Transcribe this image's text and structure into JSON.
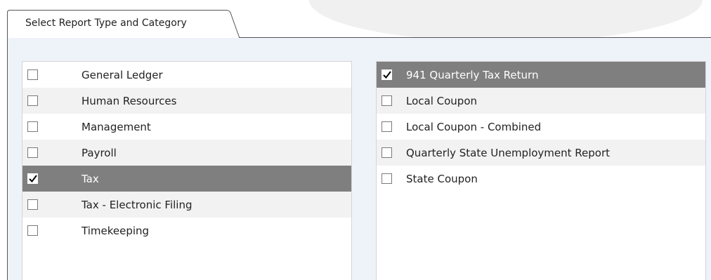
{
  "tab": {
    "label": "Select Report Type and Category"
  },
  "categories": {
    "items": [
      {
        "label": "General Ledger",
        "checked": false
      },
      {
        "label": "Human Resources",
        "checked": false
      },
      {
        "label": "Management",
        "checked": false
      },
      {
        "label": "Payroll",
        "checked": false
      },
      {
        "label": "Tax",
        "checked": true
      },
      {
        "label": "Tax - Electronic Filing",
        "checked": false
      },
      {
        "label": "Timekeeping",
        "checked": false
      }
    ]
  },
  "reports": {
    "items": [
      {
        "label": "941 Quarterly Tax Return",
        "checked": true
      },
      {
        "label": "Local Coupon",
        "checked": false
      },
      {
        "label": "Local Coupon - Combined",
        "checked": false
      },
      {
        "label": "Quarterly State Unemployment Report",
        "checked": false
      },
      {
        "label": "State Coupon",
        "checked": false
      }
    ]
  },
  "colors": {
    "selected_row": "#7f7f7f",
    "alt_row": "#f2f2f2",
    "panel_background": "#eef3fa"
  }
}
